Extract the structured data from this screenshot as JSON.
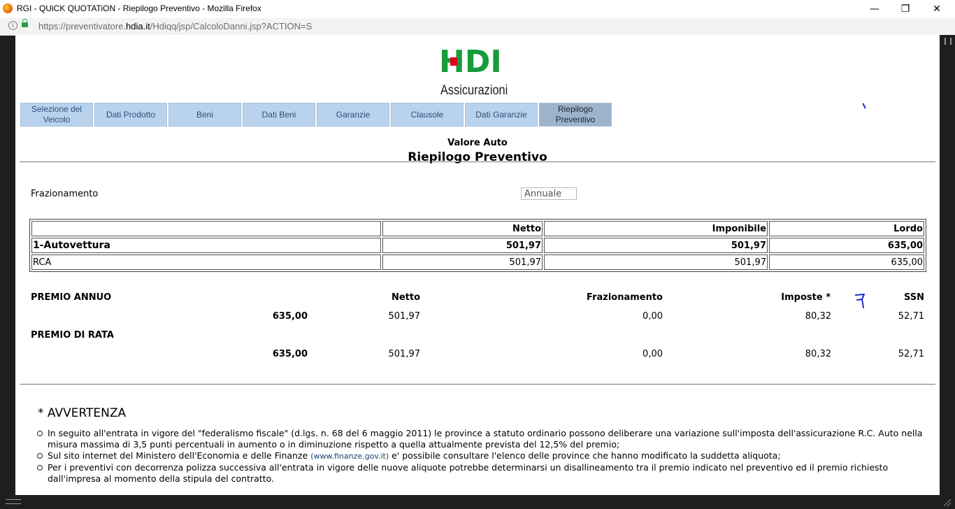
{
  "window": {
    "title": "RGI - QUiCK QUOTATiON - Riepilogo Preventivo - Mozilla Firefox",
    "url_prefix": "https://preventivatore.",
    "url_domain": "hdia.it",
    "url_path": "/Hdiqq/jsp/CalcoloDanni.jsp?ACTION=S",
    "minimize": "—",
    "restore": "❐",
    "close": "✕"
  },
  "logo": {
    "letters": "HDI",
    "subtitle": "Assicurazioni"
  },
  "tabs": [
    {
      "label": "Selezione del Veicolo"
    },
    {
      "label": "Dati Prodotto"
    },
    {
      "label": "Beni"
    },
    {
      "label": "Dati Beni"
    },
    {
      "label": "Garanzie"
    },
    {
      "label": "Clausole"
    },
    {
      "label": "Dati Garanzie"
    },
    {
      "label": "Riepilogo Preventivo"
    }
  ],
  "header": {
    "subtitle": "Valore Auto",
    "title": "Riepilogo Preventivo"
  },
  "frazionamento": {
    "label": "Frazionamento",
    "value": "Annuale"
  },
  "premium_table": {
    "columns": [
      "",
      "Netto",
      "Imponibile",
      "Lordo"
    ],
    "rows": [
      {
        "name": "1-Autovettura",
        "netto": "501,97",
        "imponibile": "501,97",
        "lordo": "635,00"
      },
      {
        "name": "RCA",
        "netto": "501,97",
        "imponibile": "501,97",
        "lordo": "635,00"
      }
    ]
  },
  "summary": {
    "col_netto": "Netto",
    "col_frazionamento": "Frazionamento",
    "col_imposte": "Imposte *",
    "col_ssn": "SSN",
    "annuo": {
      "label": "PREMIO ANNUO",
      "total": "635,00",
      "netto": "501,97",
      "frazionamento": "0,00",
      "imposte": "80,32",
      "ssn": "52,71"
    },
    "rata": {
      "label": "PREMIO DI RATA",
      "total": "635,00",
      "netto": "501,97",
      "frazionamento": "0,00",
      "imposte": "80,32",
      "ssn": "52,71"
    }
  },
  "warning": {
    "title": "* AVVERTENZA",
    "note1": "In seguito all'entrata in vigore del \"federalismo fiscale\" (d.lgs. n. 68 del 6 maggio 2011) le province a statuto ordinario possono deliberare una variazione sull'imposta dell'assicurazione R.C. Auto nella misura massima di 3,5 punti percentuali in aumento o in diminuzione rispetto a quella attualmente prevista del 12,5% del premio;",
    "note2_before": "Sul sito internet del Ministero dell'Economia e delle Finanze ",
    "note2_link": "(www.finanze.gov.it)",
    "note2_after": " e' possibile consultare l'elenco delle province che hanno modificato la suddetta aliquota;",
    "note3": "Per i preventivi con decorrenza polizza successiva all'entrata in vigore delle nuove aliquote potrebbe determinarsi un disallineamento tra il premio indicato nel preventivo ed il premio richiesto dall'impresa al momento della stipula del contratto."
  },
  "colors": {
    "accent_green": "#169c3a",
    "accent_red": "#e0001b",
    "tab_bg": "#b9d3ee",
    "tab_active_bg": "#9db3cb",
    "annotation_ink": "#1b2bd1"
  },
  "icons": [
    "firefox-icon",
    "info-icon",
    "lock-icon",
    "minimize-icon",
    "restore-icon",
    "close-icon"
  ]
}
